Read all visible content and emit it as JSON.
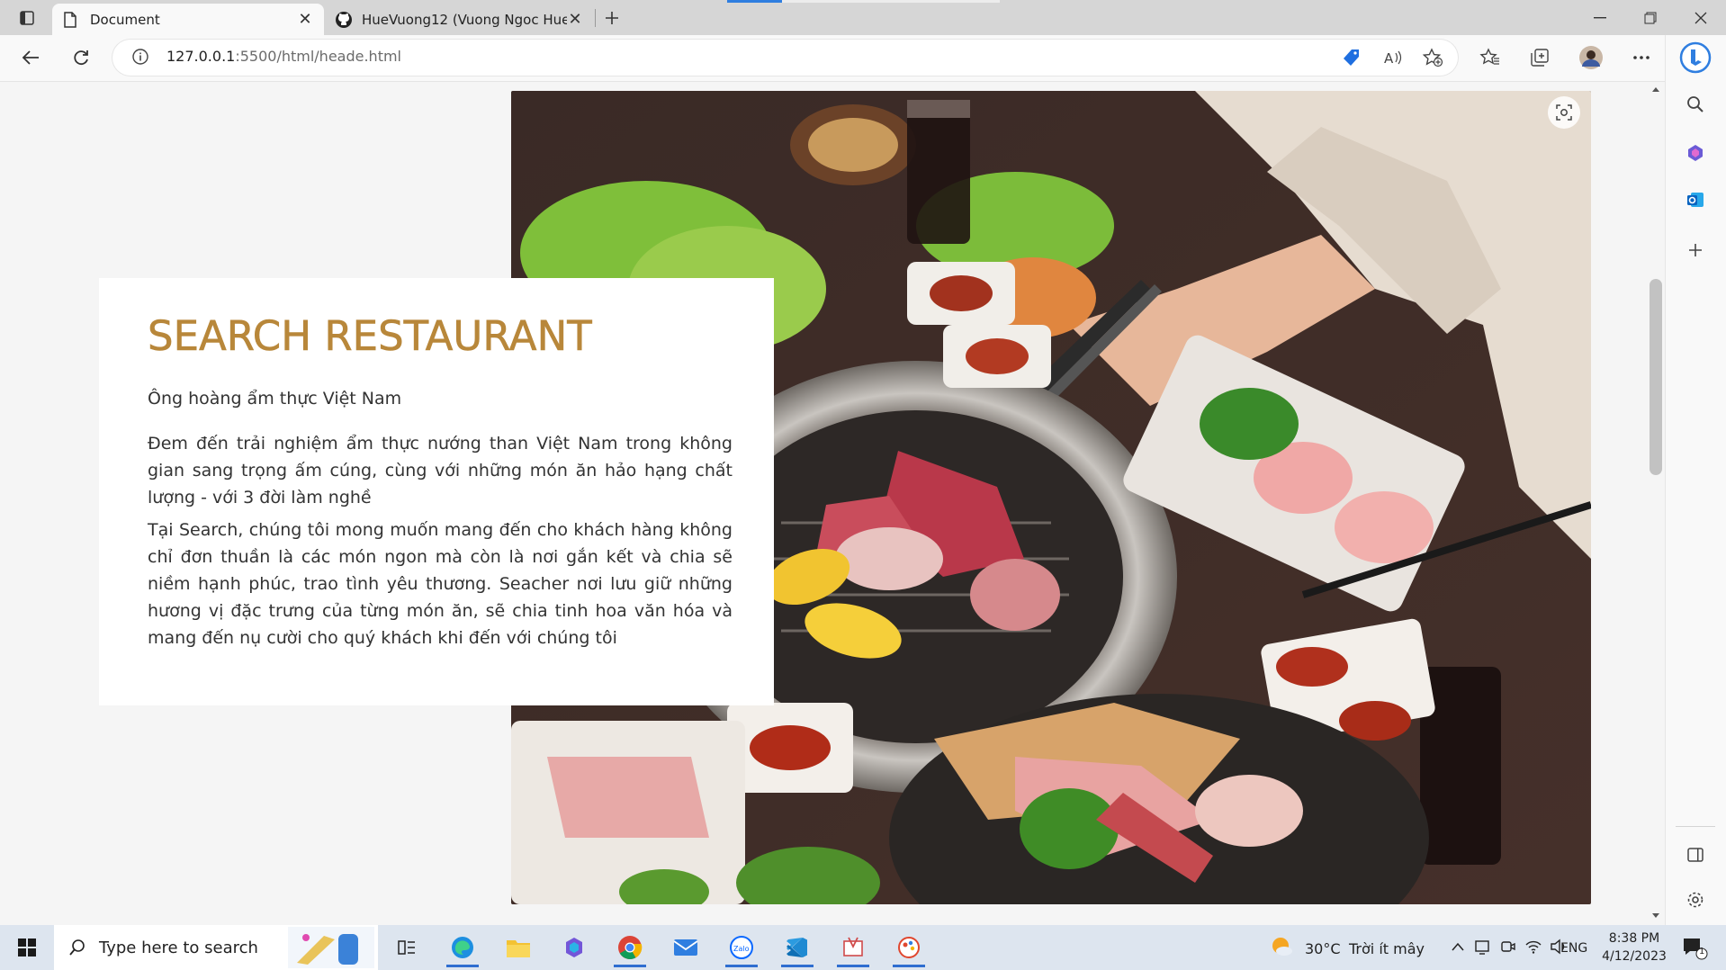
{
  "browser": {
    "tabs": [
      {
        "title": "Document",
        "icon": "document-icon",
        "active": true
      },
      {
        "title": "HueVuong12 (Vuong Ngoc Hue)",
        "icon": "github-icon",
        "active": false
      }
    ],
    "address": {
      "host": "127.0.0.1",
      "rest": ":5500/html/heade.html"
    }
  },
  "card": {
    "title": "SEARCH RESTAURANT",
    "subtitle": "Ông hoàng ẩm thực Việt Nam",
    "paragraph1": "Đem đến trải nghiệm ẩm thực nướng than Việt Nam trong không gian sang trọng ấm cúng, cùng với những món ăn hảo hạng chất lượng - với 3 đời làm nghề",
    "paragraph2": "Tại Search, chúng tôi mong muốn mang đến cho khách hàng không chỉ đơn thuần là các món ngon mà còn là nơi gắn kết và chia sẽ niềm hạnh phúc, trao tình yêu thương. Seacher nơi lưu giữ những hương vị đặc trưng của từng món ăn, sẽ chia tinh hoa văn hóa và mang đến nụ cười cho quý khách khi đến với chúng tôi"
  },
  "hero": {
    "icon": "visual-search-icon"
  },
  "taskbar": {
    "search_placeholder": "Type here to search",
    "weather": {
      "temp": "30°C",
      "desc": "Trời ít mây"
    },
    "lang": "ENG",
    "time": "8:38 PM",
    "date": "4/12/2023",
    "notifications": "1"
  },
  "colors": {
    "accent": "#b8873a",
    "taskbar": "#dde5ef",
    "edge_blue": "#2f7ee0"
  }
}
